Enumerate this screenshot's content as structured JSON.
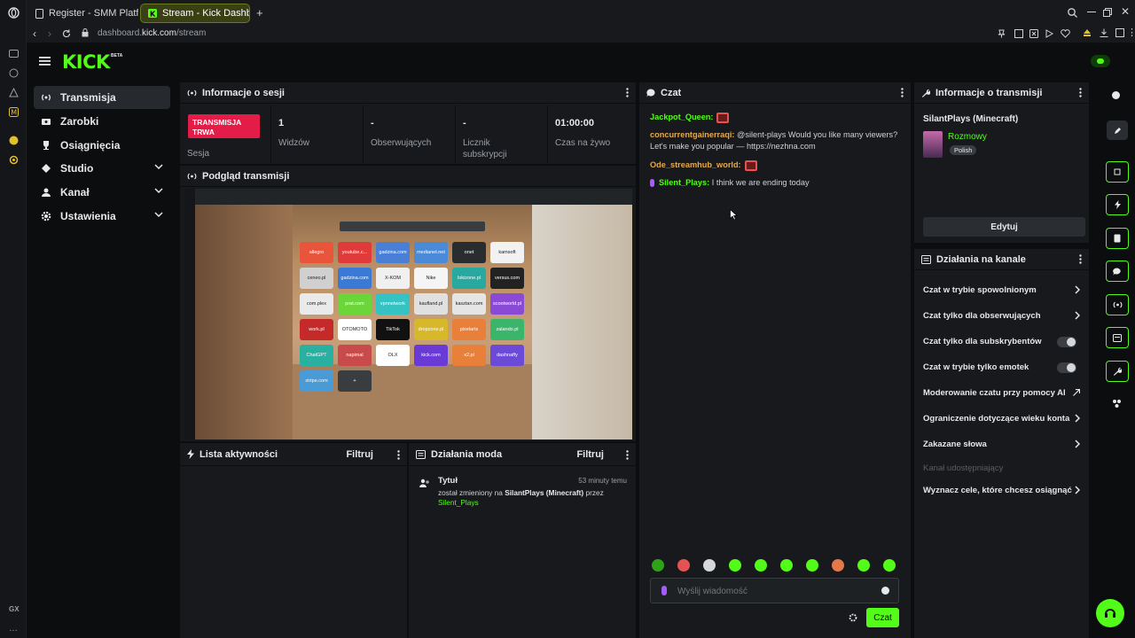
{
  "browser": {
    "tabs": [
      {
        "title": "Register - SMM Platform",
        "active": false
      },
      {
        "title": "Stream - Kick Dashboard",
        "active": true
      }
    ],
    "url_host": "dashboard.",
    "url_domain": "kick.com",
    "url_path": "/stream",
    "new_tab": "+"
  },
  "header": {
    "logo": "KICK",
    "beta": "BETA"
  },
  "sidebar": {
    "items": [
      {
        "label": "Transmisja",
        "active": true,
        "expandable": false
      },
      {
        "label": "Zarobki",
        "active": false,
        "expandable": false
      },
      {
        "label": "Osiągnięcia",
        "active": false,
        "expandable": false
      },
      {
        "label": "Studio",
        "active": false,
        "expandable": true
      },
      {
        "label": "Kanał",
        "active": false,
        "expandable": true
      },
      {
        "label": "Ustawienia",
        "active": false,
        "expandable": true
      }
    ]
  },
  "session": {
    "title": "Informacje o sesji",
    "live_badge": "TRANSMISJA TRWA",
    "label": "Sesja",
    "stats": [
      {
        "value": "1",
        "label": "Widzów"
      },
      {
        "value": "-",
        "label": "Obserwujących"
      },
      {
        "value": "-",
        "label": "Licznik subskrypcji"
      },
      {
        "value": "01:00:00",
        "label": "Czas na żywo"
      }
    ]
  },
  "preview": {
    "title": "Podgląd transmisji",
    "speed_dial": [
      "allegro",
      "youtube.c...",
      "gadzina.com",
      "medianet.net",
      "onet",
      "kamsoft",
      "ceneo.pl",
      "gadzina.com",
      "X-KOM",
      "Nike",
      "lokizone.pl",
      "versus.com",
      "com.plex",
      "prat.com",
      "vpnnetwork",
      "kaufland.pl",
      "kasztan.com",
      "scootworld.pl",
      "work.pl",
      "OTOMOTO",
      "TikTok",
      "dropzone.pl",
      "pixelarts",
      "zalando.pl",
      "ChatGPT",
      "napimal",
      "OLX",
      "kick.com",
      "x2.pl",
      "dashnaffy",
      "stripe.com",
      "+"
    ]
  },
  "activity": {
    "title": "Lista aktywności",
    "filter": "Filtruj"
  },
  "mod_actions": {
    "title": "Działania moda",
    "filter": "Filtruj",
    "entry": {
      "heading": "Tytuł",
      "time": "53 minuty temu",
      "text_prefix": "został zmieniony na",
      "new_title": "SilantPlays (Minecraft)",
      "text_by": "przez",
      "user": "Silent_Plays"
    }
  },
  "chat": {
    "title": "Czat",
    "messages": [
      {
        "user": "Jackpot_Queen:",
        "text": "",
        "color": "#53fc18",
        "emote": true
      },
      {
        "user": "concurrentgainerraqi:",
        "text": " @silent-plays Would you like many viewers? Let's make you popular — https://nezhna.com",
        "color": "#e7a94a",
        "emote": false
      },
      {
        "user": "Ode_streamhub_world:",
        "text": "",
        "color": "#e7a94a",
        "emote": true
      },
      {
        "user": "Silent_Plays:",
        "text": " I think we are ending today",
        "color": "#53fc18",
        "emote": false
      }
    ],
    "placeholder": "Wyślij wiadomość",
    "send_label": "Czat"
  },
  "stream_info": {
    "title": "Informacje o transmisji",
    "stream_title": "SilantPlays (Minecraft)",
    "category": "Rozmowy",
    "tag": "Polish",
    "edit_label": "Edytuj"
  },
  "channel_actions": {
    "title": "Działania na kanale",
    "items": [
      {
        "label": "Czat w trybie spowolnionym",
        "control": "chevron"
      },
      {
        "label": "Czat tylko dla obserwujących",
        "control": "chevron"
      },
      {
        "label": "Czat tylko dla subskrybentów",
        "control": "toggle"
      },
      {
        "label": "Czat w trybie tylko emotek",
        "control": "toggle"
      },
      {
        "label": "Moderowanie czatu przy pomocy AI",
        "control": "external"
      },
      {
        "label": "Ograniczenie dotyczące wieku konta",
        "control": "chevron"
      },
      {
        "label": "Zakazane słowa",
        "control": "chevron"
      },
      {
        "label": "Kanał udostępniający",
        "control": "disabled"
      },
      {
        "label": "Wyznacz cele, które chcesz osiągnąć",
        "control": "chevron"
      }
    ]
  },
  "opera_sidebar": {
    "footer": "GX"
  },
  "colors": {
    "accent": "#53fc18",
    "live": "#e31c48",
    "panel": "#17191c",
    "bg": "#0b0d0f"
  }
}
